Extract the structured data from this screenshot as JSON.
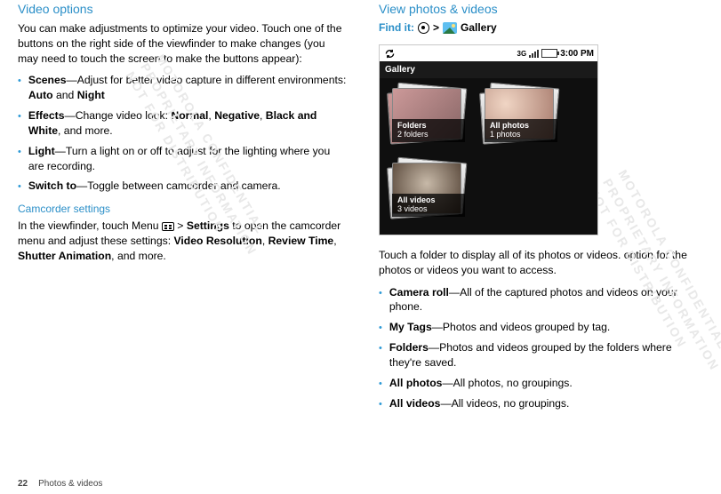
{
  "left": {
    "h_video_options": "Video options",
    "intro": "You can make adjustments to optimize your video. Touch one of the buttons on the right side of the viewfinder to make changes (you may need to touch the screen to make the buttons appear):",
    "bullets": {
      "scenes_label": "Scenes",
      "scenes_rest": "—Adjust for better video capture in different environments: ",
      "scenes_v1": "Auto",
      "scenes_and": " and ",
      "scenes_v2": "Night",
      "effects_label": "Effects",
      "effects_rest": "—Change video look: ",
      "effects_v1": "Normal",
      "effects_c1": ", ",
      "effects_v2": "Negative",
      "effects_c2": ", ",
      "effects_v3": "Black and White",
      "effects_tail": ", and more.",
      "light_label": "Light",
      "light_rest": "—Turn a light on or off to adjust for the lighting where you are recording.",
      "switch_label": "Switch to",
      "switch_rest": "—Toggle between camcorder and camera."
    },
    "h_camcorder": "Camcorder settings",
    "camcorder_p1a": "In the viewfinder, touch Menu ",
    "camcorder_p1b": " > ",
    "camcorder_settings": "Settings",
    "camcorder_p1c": " to open the camcorder menu and adjust these settings: ",
    "camcorder_v1": "Video Resolution",
    "camcorder_c1": ", ",
    "camcorder_v2": "Review Time",
    "camcorder_c2": ", ",
    "camcorder_v3": "Shutter Animation",
    "camcorder_tail": ", and more."
  },
  "right": {
    "h_view": "View photos & videos",
    "find_it": "Find it:",
    "gt": ">",
    "gallery_word": "Gallery",
    "status_time": "3:00 PM",
    "sig3g": "3G",
    "topbar": "Gallery",
    "tiles": [
      {
        "title": "Folders",
        "sub": "2 folders"
      },
      {
        "title": "All photos",
        "sub": "1 photos"
      },
      {
        "title": "All videos",
        "sub": "3 videos"
      }
    ],
    "touch_folder": "Touch a folder to display all of its photos or videos. option for the photos or videos you want to access.",
    "bullets": {
      "cam_label": "Camera roll",
      "cam_rest": "—All of the captured photos and videos on your phone.",
      "tags_label": "My Tags",
      "tags_rest": "—Photos and videos grouped by tag.",
      "folders_label": "Folders",
      "folders_rest": "—Photos and videos grouped by the folders where they're saved.",
      "photos_label": "All photos",
      "photos_rest": "—All photos, no groupings.",
      "videos_label": "All videos",
      "videos_rest": "—All videos, no groupings."
    }
  },
  "footer": {
    "page": "22",
    "section": "Photos & videos"
  },
  "watermark": "MOTOROLA CONFIDENTIAL\nPROPRIETARY INFORMATION\nNOT FOR DISTRIBUTION"
}
